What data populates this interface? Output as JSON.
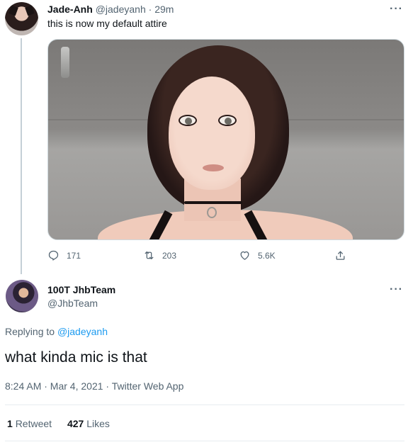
{
  "parent_tweet": {
    "name": "Jade-Anh",
    "handle": "@jadeyanh",
    "separator": "·",
    "time": "29m",
    "text": "this is now my default attire",
    "more_icon": "···",
    "actions": {
      "replies": "171",
      "retweets": "203",
      "likes": "5.6K"
    }
  },
  "main_tweet": {
    "name": "100T JhbTeam",
    "handle": "@JhbTeam",
    "more_icon": "···",
    "replying_prefix": "Replying to",
    "replying_handle": "@jadeyanh",
    "text": "what kinda mic is that",
    "timestamp": "8:24 AM · Mar 4, 2021 · Twitter Web App",
    "stats": {
      "retweets_count": "1",
      "retweets_label": "Retweet",
      "likes_count": "427",
      "likes_label": "Likes"
    }
  },
  "colors": {
    "text_primary": "#0f1419",
    "text_secondary": "#536471",
    "link": "#1d9bf0",
    "thread_line": "#c4cfd6"
  },
  "icons": [
    "reply-icon",
    "retweet-icon",
    "like-icon",
    "share-icon",
    "more-icon"
  ]
}
